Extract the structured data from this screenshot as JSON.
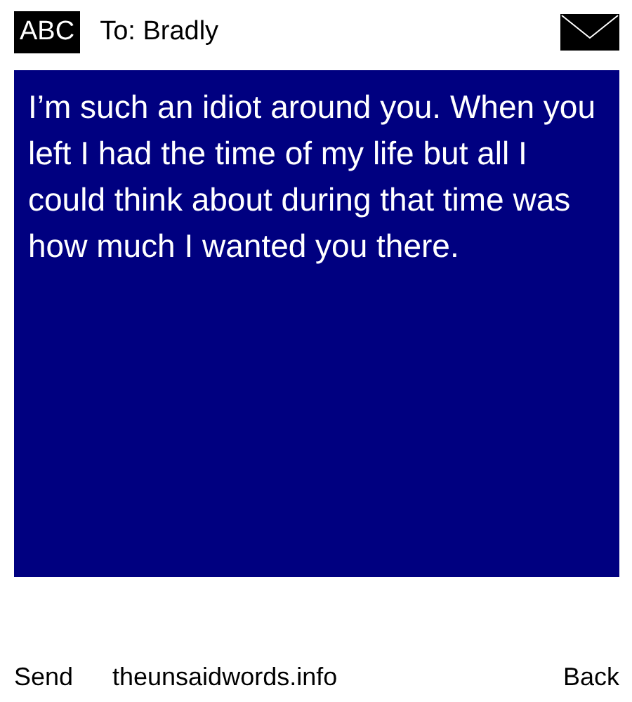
{
  "header": {
    "input_mode": "ABC",
    "recipient": "To: Bradly"
  },
  "message": {
    "text": "I’m such an idiot around you. When you left I had the time of my life but all I could think about during that time was how much I wanted you there."
  },
  "footer": {
    "left": "Send",
    "center": "theunsaidwords.info",
    "right": "Back"
  }
}
